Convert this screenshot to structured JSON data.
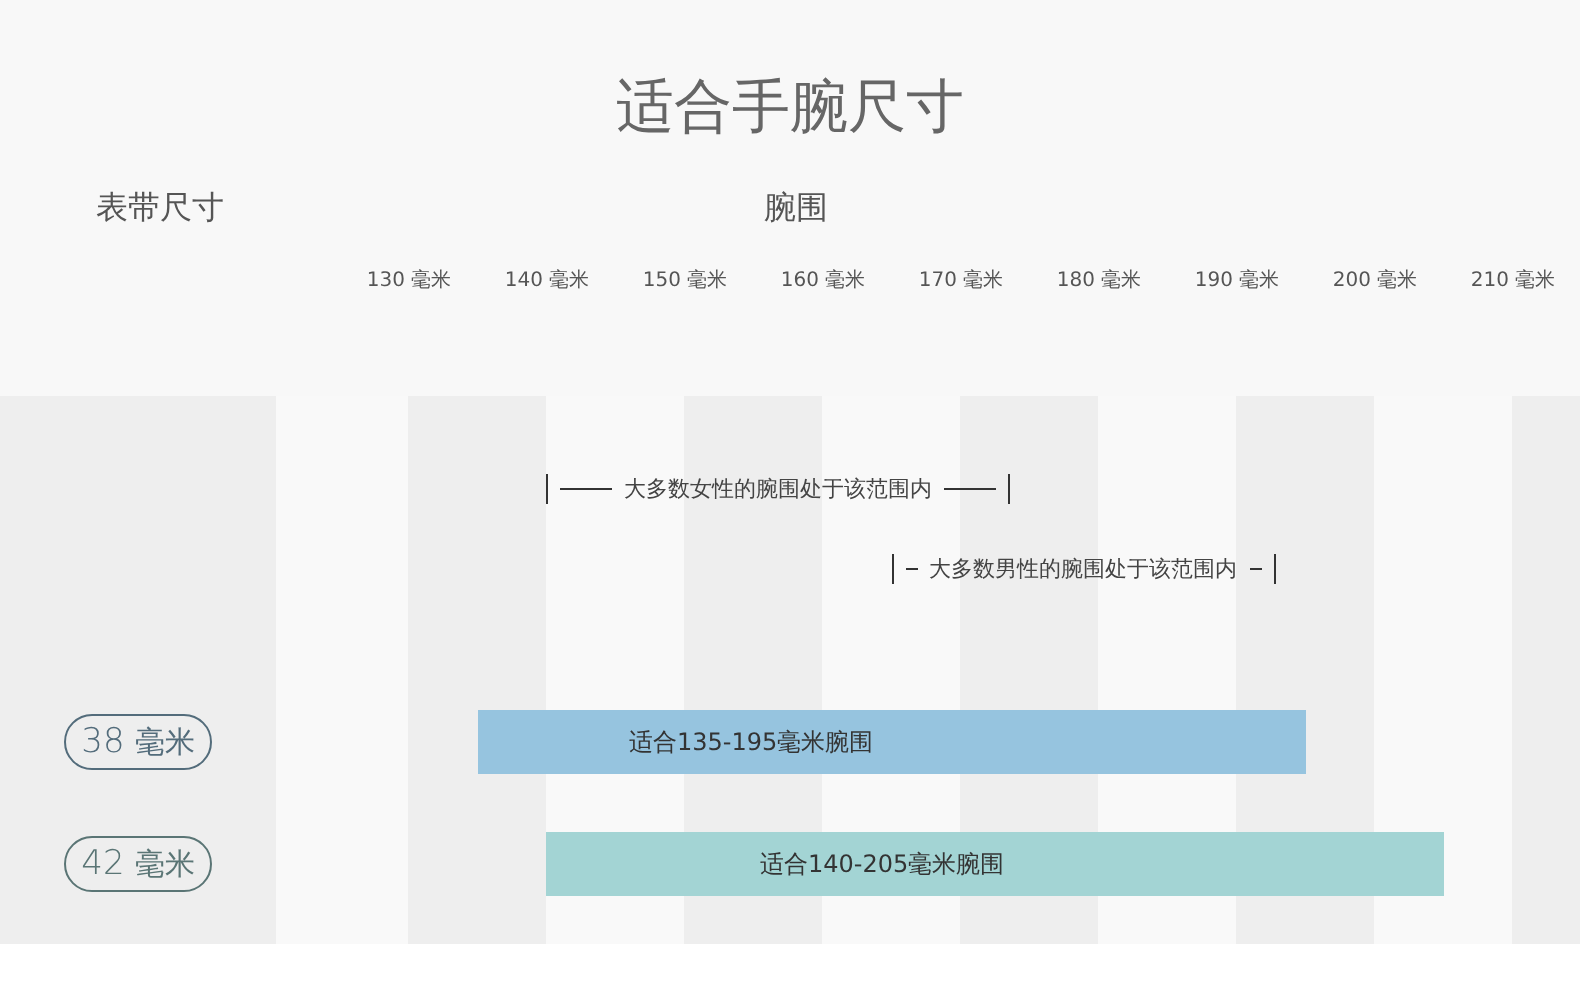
{
  "title": "适合手腕尺寸",
  "size_header": "表带尺寸",
  "wrist_header": "腕围",
  "ticks": [
    "130 毫米",
    "140 毫米",
    "150 毫米",
    "160 毫米",
    "170 毫米",
    "180 毫米",
    "190 毫米",
    "200 毫米",
    "210 毫米"
  ],
  "notes": [
    "大多数女性的腕围处于该范围内",
    "大多数男性的腕围处于该范围内"
  ],
  "bands": [
    {
      "size": "38",
      "unit": "毫米",
      "label": "适合135-195毫米腕围",
      "color": "#96c4df"
    },
    {
      "size": "42",
      "unit": "毫米",
      "label": "适合140-205毫米腕围",
      "color": "#a3d4d4"
    }
  ]
}
